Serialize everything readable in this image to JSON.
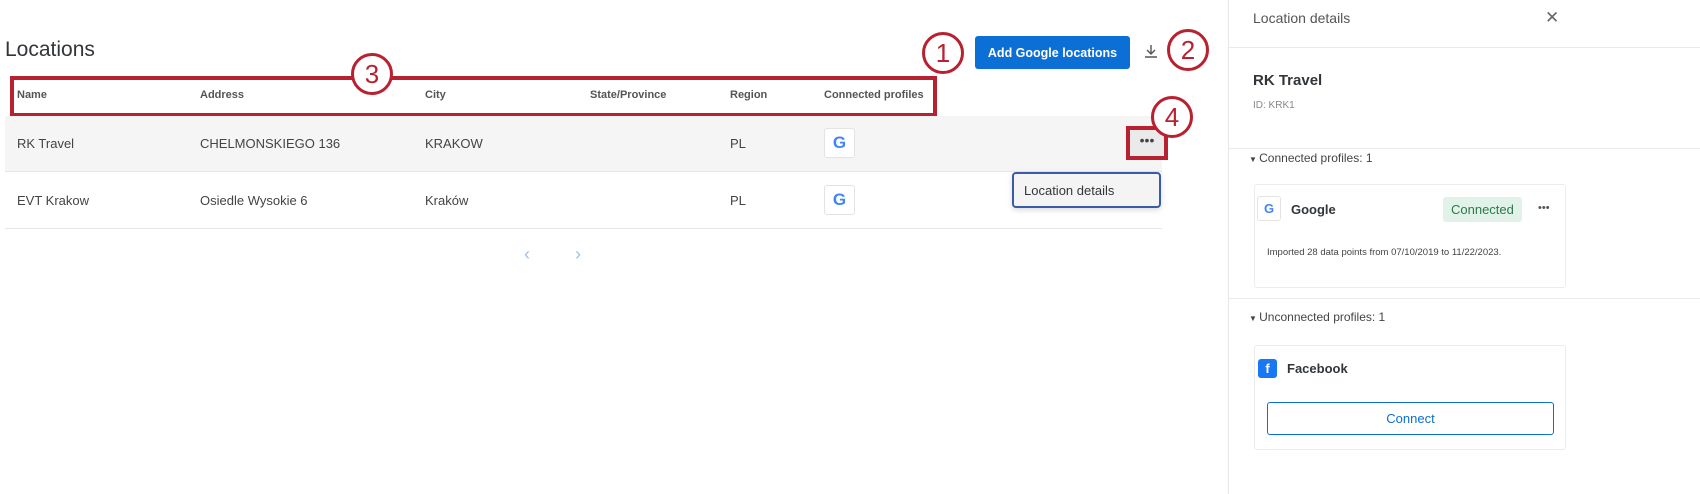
{
  "page": {
    "title": "Locations",
    "add_button": "Add Google locations",
    "download_icon": "download-icon"
  },
  "table": {
    "headers": [
      "Name",
      "Address",
      "City",
      "State/Province",
      "Region",
      "Connected profiles"
    ],
    "rows": [
      {
        "name": "RK Travel",
        "address": "CHELMONSKIEGO 136",
        "city": "KRAKOW",
        "state": "",
        "region": "PL",
        "profile": "G"
      },
      {
        "name": "EVT Krakow",
        "address": "Osiedle Wysokie 6",
        "city": "Kraków",
        "state": "",
        "region": "PL",
        "profile": "G"
      }
    ],
    "more": "•••",
    "menu_item": "Location details",
    "prev": "‹",
    "next": "›"
  },
  "callouts": [
    "1",
    "2",
    "3",
    "4"
  ],
  "panel": {
    "title": "Location details",
    "close": "✕",
    "name": "RK Travel",
    "id": "ID: KRK1",
    "connected_header": "Connected profiles: 1",
    "connected": {
      "icon": "G",
      "name": "Google",
      "status": "Connected",
      "more": "•••",
      "note": "Imported 28 data points from 07/10/2019 to 11/22/2023."
    },
    "unconnected_header": "Unconnected profiles: 1",
    "unconnected": {
      "icon": "f",
      "name": "Facebook",
      "button": "Connect"
    }
  },
  "colors": {
    "accent": "#0b6fd6",
    "annotation": "#b82130",
    "connected_bg": "#e1f2e8"
  }
}
